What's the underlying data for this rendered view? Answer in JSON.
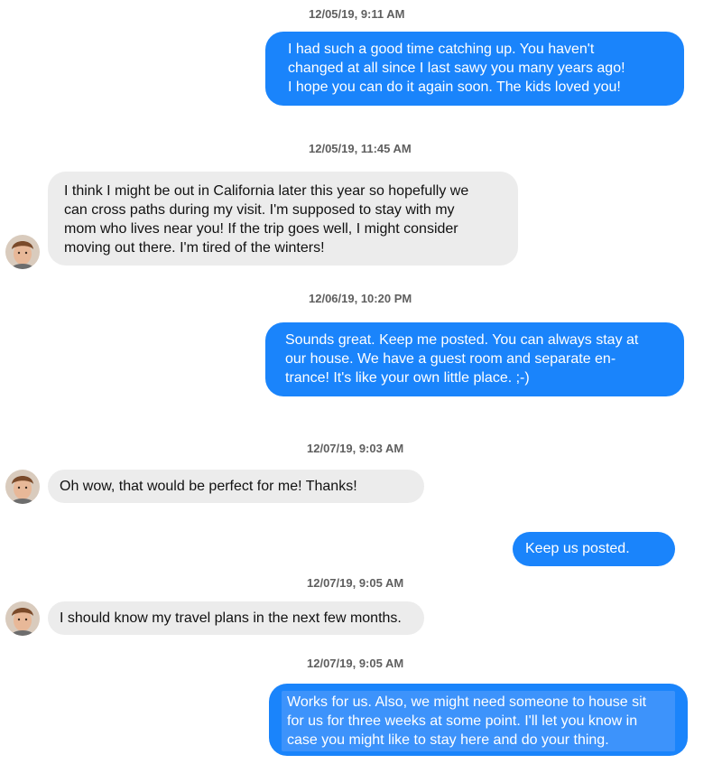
{
  "messages": [
    {
      "timestamp": "12/05/19, 9:11 AM",
      "side": "out",
      "text": "I had such a good time catching up. You haven't\nchanged at all since I last sawy you many years ago!\nI hope you can do it again soon. The kids loved you!"
    },
    {
      "timestamp": "12/05/19, 11:45 AM",
      "side": "in",
      "text": "I think I might be out in California later this year so hopefully we\ncan cross paths during my visit. I'm supposed to stay with my\nmom who lives near you! If the trip goes well, I might consider\nmoving out there. I'm tired of the winters!"
    },
    {
      "timestamp": "12/06/19, 10:20 PM",
      "side": "out",
      "text": "Sounds great. Keep me posted. You can always stay at\nour house. We have a guest room and separate en-\ntrance! It's like your own little place. ;-)"
    },
    {
      "timestamp": "12/07/19, 9:03 AM",
      "side": "in",
      "text": "Oh wow, that would be perfect for me! Thanks!"
    },
    {
      "timestamp": "",
      "side": "out",
      "text": "Keep us posted."
    },
    {
      "timestamp": "12/07/19, 9:05 AM",
      "side": "in",
      "text": "I should know my travel plans in the next few months."
    },
    {
      "timestamp": "12/07/19, 9:05 AM",
      "side": "out",
      "text": "Works for us. Also, we might need someone to house sit\nfor us for three weeks at some point. I'll let you know in\ncase you might like to stay here and do your thing."
    }
  ],
  "colors": {
    "outgoing": "#1a84fb",
    "incoming": "#ececec",
    "timestamp": "#5f5f5f"
  },
  "icons": {
    "avatar": "contact-avatar-icon"
  }
}
